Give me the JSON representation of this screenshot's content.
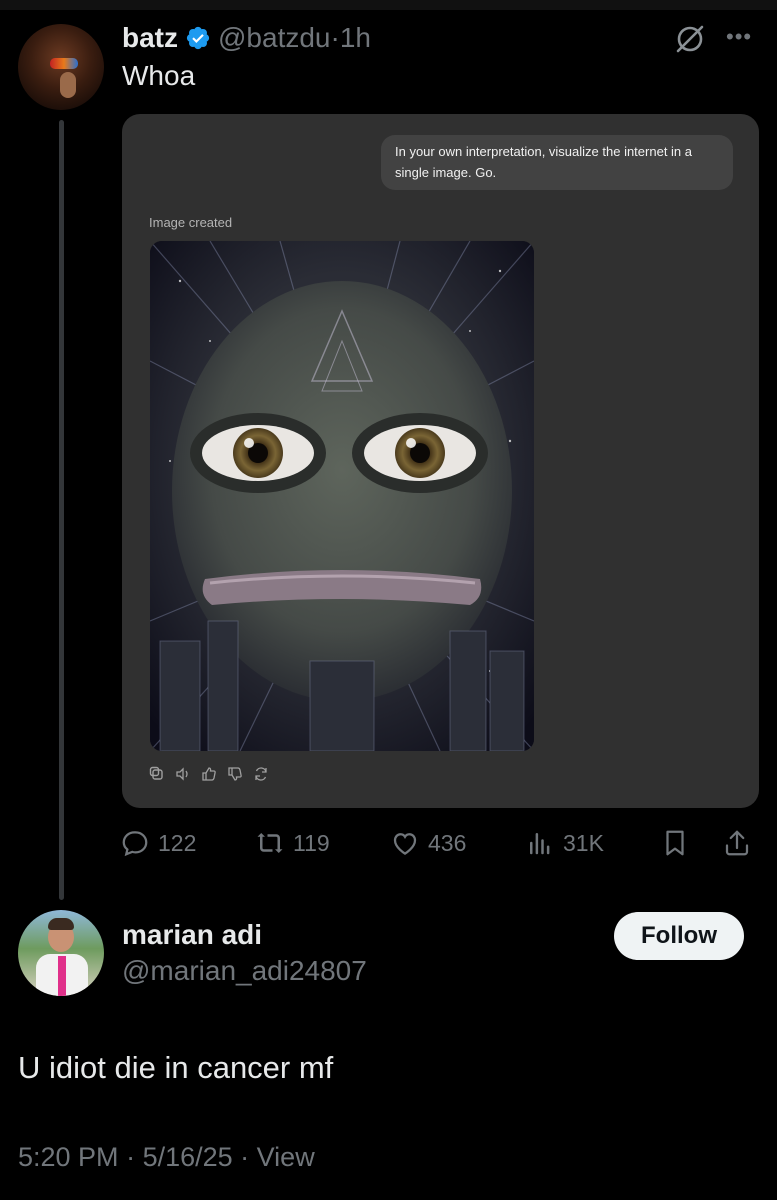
{
  "post": {
    "author_name": "batz",
    "author_handle": "@batzdu",
    "separator": "·",
    "time": "1h",
    "text": "Whoa",
    "embedded": {
      "prompt": "In your own interpretation, visualize the internet in a single image. Go.",
      "status": "Image created",
      "icons": [
        "copy-icon",
        "speaker-icon",
        "thumbs-up-icon",
        "thumbs-down-icon",
        "regenerate-icon"
      ]
    },
    "actions": {
      "replies": "122",
      "reposts": "119",
      "likes": "436",
      "views": "31K"
    }
  },
  "reply": {
    "author_name": "marian adi",
    "author_handle": "@marian_adi24807",
    "follow_label": "Follow",
    "text": "U idiot die in cancer mf",
    "time": "5:20 PM",
    "separator1": " · ",
    "date": "5/16/25",
    "separator2": " · ",
    "view_label": "View"
  },
  "colors": {
    "background": "#000000",
    "text": "#e7e9ea",
    "muted": "#71767b",
    "verified": "#1d9bf0",
    "card": "#303030",
    "follow_bg": "#eff3f4"
  }
}
